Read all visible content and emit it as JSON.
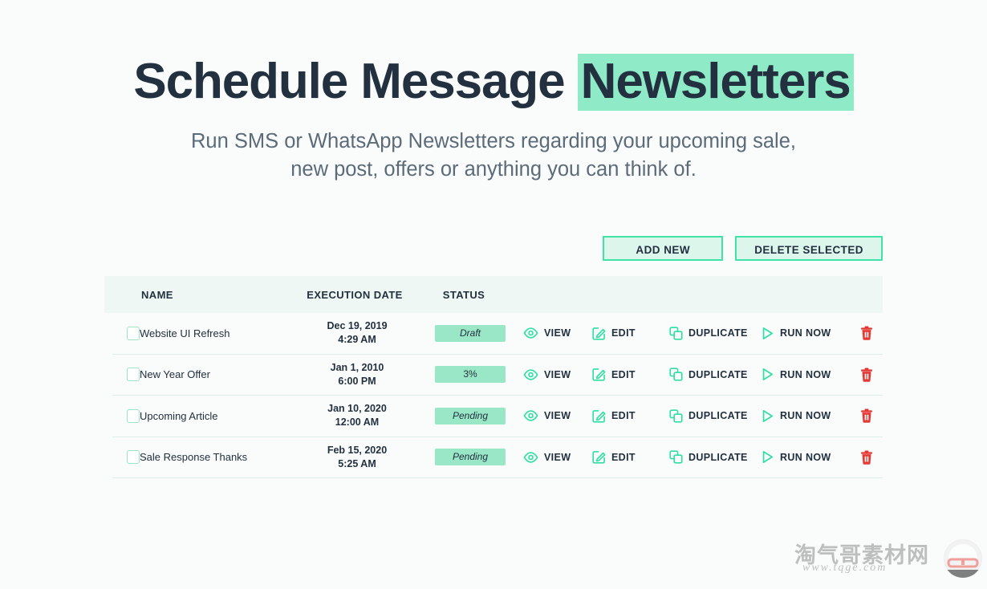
{
  "hero": {
    "title_plain": "Schedule Message ",
    "title_highlight": "Newsletters",
    "subtitle_line1": "Run SMS or WhatsApp Newsletters regarding your upcoming sale,",
    "subtitle_line2": "new post, offers or anything you can think of."
  },
  "toolbar": {
    "add_label": "ADD NEW",
    "delete_label": "DELETE SELECTED"
  },
  "table": {
    "headers": {
      "name": "NAME",
      "execution_date": "EXECUTION DATE",
      "status": "STATUS"
    },
    "actions": {
      "view": "VIEW",
      "edit": "EDIT",
      "duplicate": "DUPLICATE",
      "run_now": "RUN NOW"
    },
    "rows": [
      {
        "name": "Website UI Refresh",
        "date": "Dec 19, 2019",
        "time": "4:29 AM",
        "status": "Draft",
        "status_italic": true,
        "checked": false
      },
      {
        "name": "New Year Offer",
        "date": "Jan 1, 2010",
        "time": "6:00 PM",
        "status": "3%",
        "status_italic": false,
        "checked": false
      },
      {
        "name": "Upcoming Article",
        "date": "Jan 10, 2020",
        "time": "12:00 AM",
        "status": "Pending",
        "status_italic": true,
        "checked": false
      },
      {
        "name": "Sale Response Thanks",
        "date": "Feb 15, 2020",
        "time": "5:25 AM",
        "status": "Pending",
        "status_italic": true,
        "checked": false
      }
    ]
  },
  "watermark": {
    "text_cn": "淘气哥素材网",
    "url": "www.tqge.com"
  },
  "colors": {
    "page_bg": "#fafbfb",
    "text_dark": "#22303f",
    "subtitle": "#5b6b79",
    "mint_highlight": "#8feac8",
    "badge_mint": "#9ae7c7",
    "accent_green": "#2fe0a0",
    "button_fill": "#ddf6ec",
    "button_border": "#3fe2a7",
    "header_band": "#eff7f4",
    "divider": "#ddf0e7",
    "trash_red": "#e53935"
  }
}
